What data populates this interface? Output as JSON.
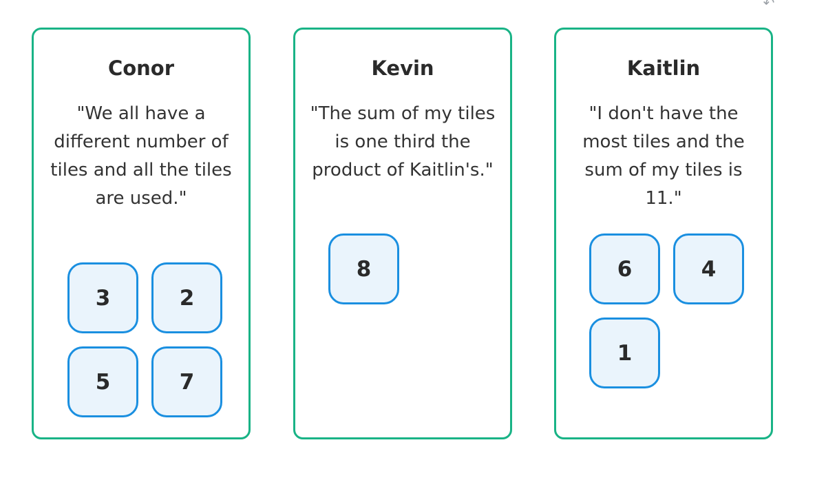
{
  "players": [
    {
      "name": "Conor",
      "quote": "\"We all have a different number of tiles and all the tiles are used.\"",
      "tiles": [
        "3",
        "2",
        "5",
        "7"
      ]
    },
    {
      "name": "Kevin",
      "quote": "\"The sum of my tiles is one third the product of Kaitlin's.\"",
      "tiles": [
        "8"
      ]
    },
    {
      "name": "Kaitlin",
      "quote": "\"I don't have the most tiles and the sum of my tiles is 11.\"",
      "tiles": [
        "6",
        "4",
        "1"
      ]
    }
  ],
  "colors": {
    "card_border": "#19b386",
    "tile_border": "#1a8fe0",
    "tile_fill": "#eaf4fc"
  },
  "icons": {
    "corner": "undo-arrow-icon"
  }
}
